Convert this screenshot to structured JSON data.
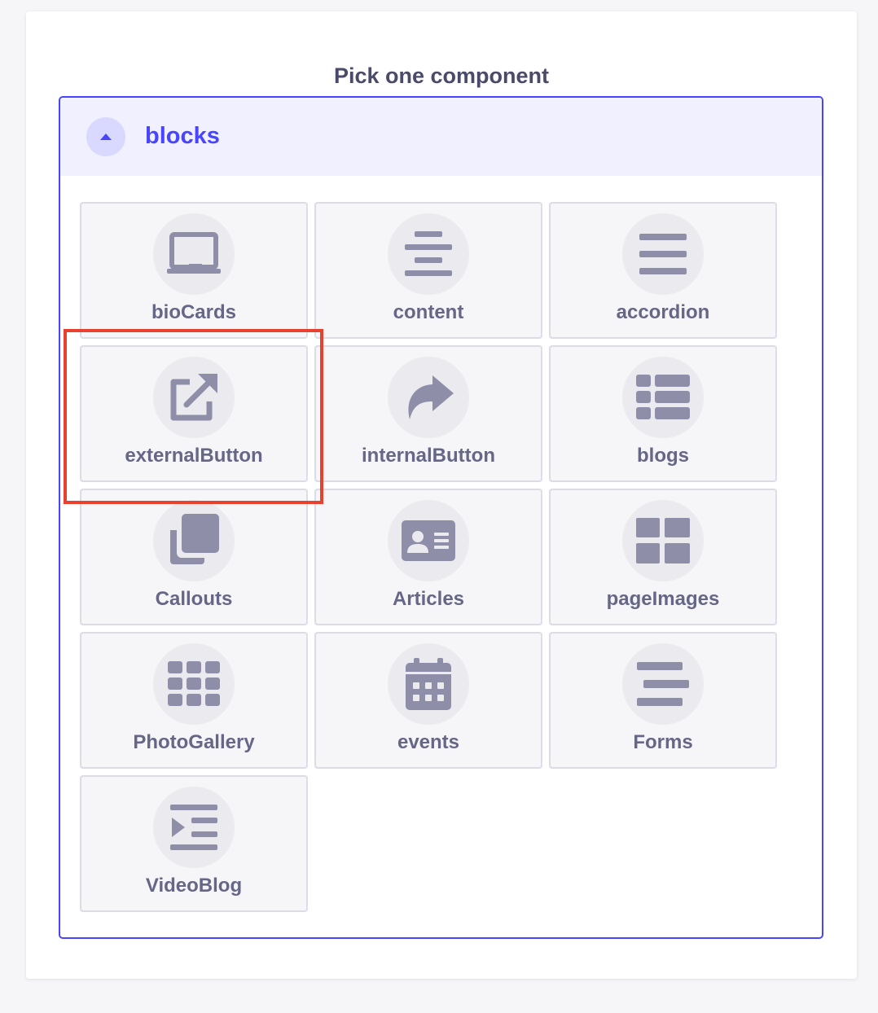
{
  "title": "Pick one component",
  "category": {
    "label": "blocks",
    "expanded": true
  },
  "components": [
    {
      "label": "bioCards",
      "icon": "laptop-icon"
    },
    {
      "label": "content",
      "icon": "align-center-icon"
    },
    {
      "label": "accordion",
      "icon": "bars-icon"
    },
    {
      "label": "externalButton",
      "icon": "external-link-icon"
    },
    {
      "label": "internalButton",
      "icon": "share-arrow-icon"
    },
    {
      "label": "blogs",
      "icon": "table-list-icon"
    },
    {
      "label": "Callouts",
      "icon": "clone-icon"
    },
    {
      "label": "Articles",
      "icon": "id-card-icon"
    },
    {
      "label": "pageImages",
      "icon": "grid-2x2-icon"
    },
    {
      "label": "PhotoGallery",
      "icon": "grid-3x3-icon"
    },
    {
      "label": "events",
      "icon": "calendar-icon"
    },
    {
      "label": "Forms",
      "icon": "align-right-icon"
    },
    {
      "label": "VideoBlog",
      "icon": "indent-icon"
    }
  ],
  "colors": {
    "accent": "#4945ff",
    "icon": "#8e8ea9",
    "highlight": "#e8412f"
  }
}
